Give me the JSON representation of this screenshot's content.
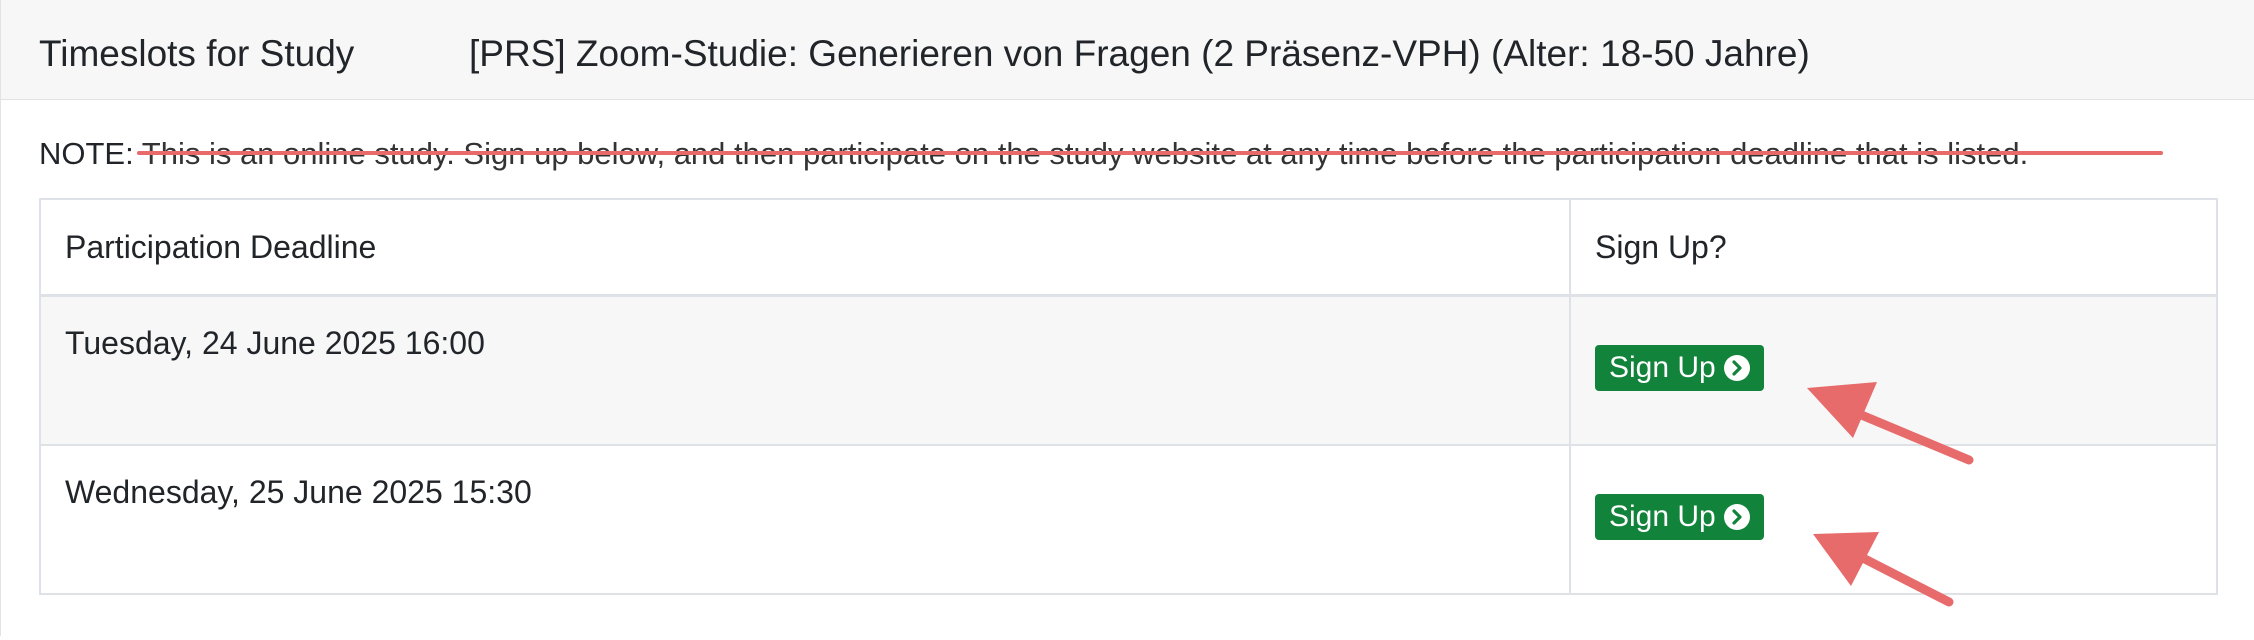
{
  "header": {
    "title": "Timeslots for Study",
    "study_name": "[PRS] Zoom-Studie: Generieren von Fragen (2 Präsenz-VPH) (Alter: 18-50 Jahre)"
  },
  "note": {
    "label": "NOTE:",
    "text": " This is an online study. Sign up below, and then participate on the study website at any time before the participation deadline that is listed."
  },
  "table": {
    "columns": [
      "Participation Deadline",
      "Sign Up?"
    ],
    "rows": [
      {
        "deadline": "Tuesday, 24 June 2025 16:00",
        "button_label": "Sign Up"
      },
      {
        "deadline": "Wednesday, 25 June 2025 15:30",
        "button_label": "Sign Up"
      }
    ]
  },
  "colors": {
    "button": "#12833a",
    "annotation": "#e86b6b",
    "header_bg": "#f7f7f7"
  },
  "icons": {
    "signup": "chevron-right-circle-icon",
    "annotation": "arrow-pointer-icon"
  }
}
